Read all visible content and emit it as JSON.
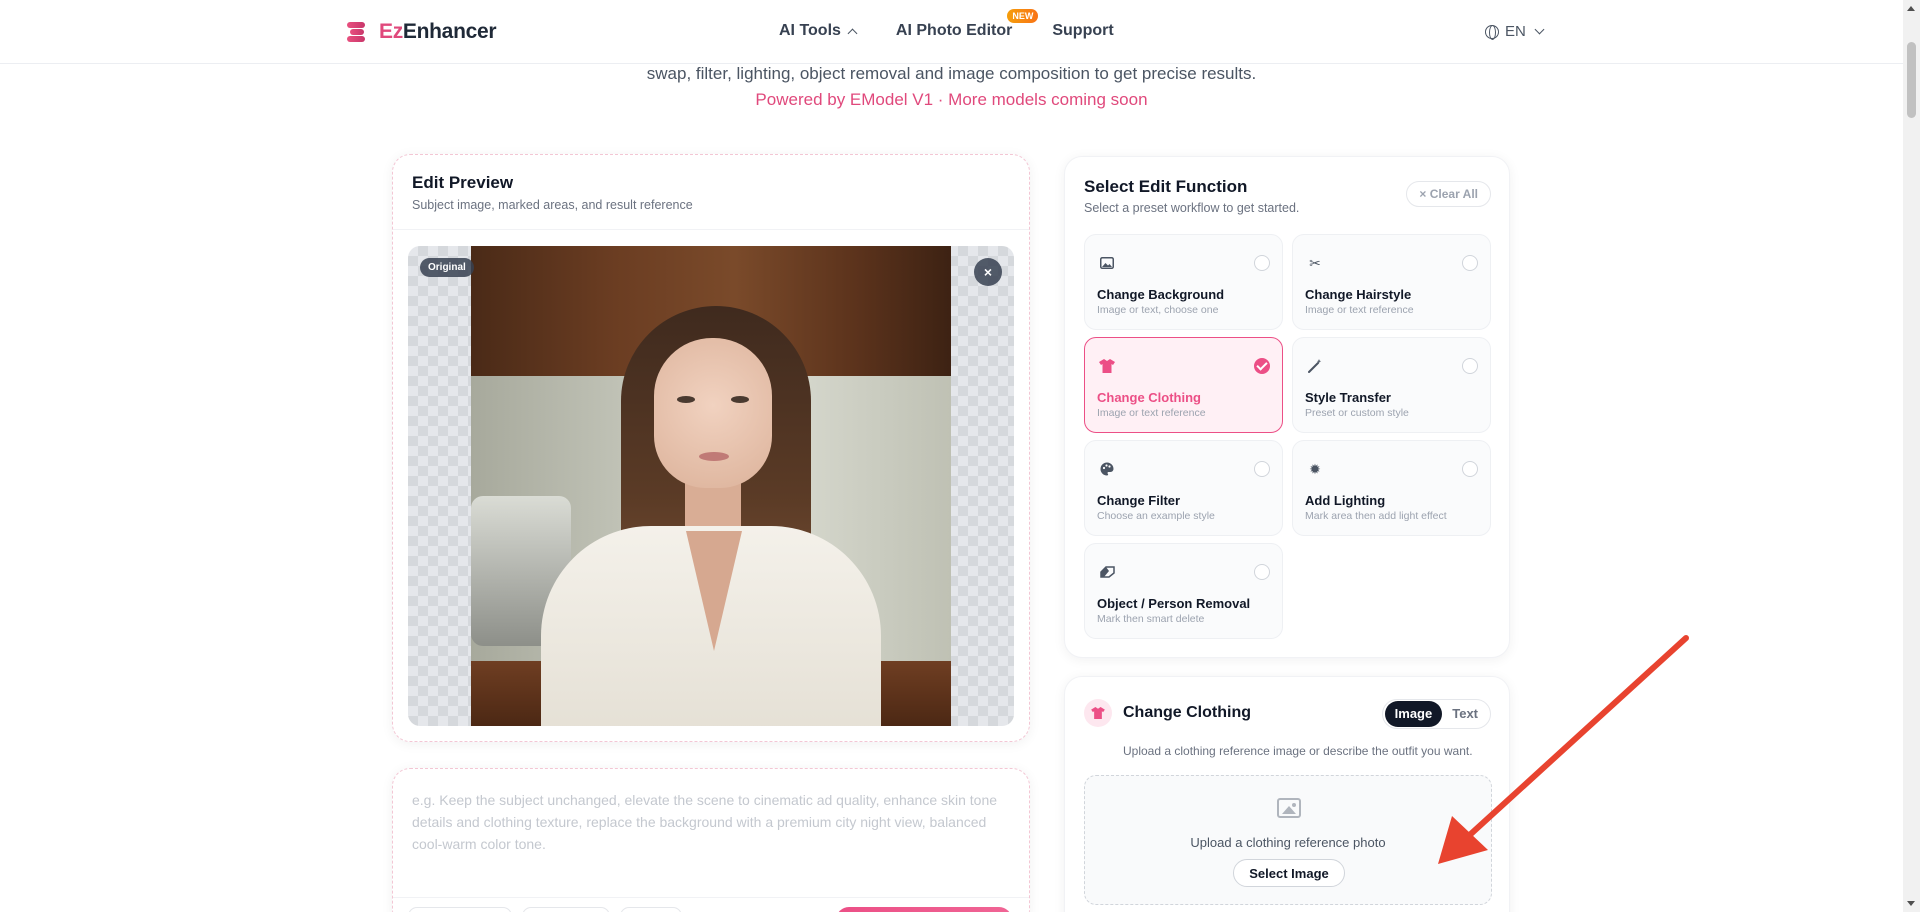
{
  "header": {
    "logo": {
      "prefix": "Ez",
      "suffix": "Enhancer"
    },
    "nav": {
      "ai_tools": "AI Tools",
      "photo_editor": "AI Photo Editor",
      "photo_editor_badge": "NEW",
      "support": "Support"
    },
    "language": "EN"
  },
  "hero": {
    "description": "swap, filter, lighting, object removal and image composition to get precise results.",
    "powered_by": "Powered by EModel V1 · More models coming soon"
  },
  "preview": {
    "title": "Edit Preview",
    "subtitle": "Subject image, marked areas, and result reference",
    "tag": "Original",
    "close_symbol": "×"
  },
  "prompt": {
    "placeholder": "e.g. Keep the subject unchanged, elevate the scene to cinematic ad quality, enhance skin tone details and clothing texture, replace the background with a premium city night view, balanced cool-warm color tone."
  },
  "functions": {
    "title": "Select Edit Function",
    "subtitle": "Select a preset workflow to get started.",
    "clear_label": "× Clear All",
    "selected": "change-clothing",
    "options": [
      {
        "title": "Change Background",
        "desc": "Image or text, choose one",
        "icon": "image-icon"
      },
      {
        "title": "Change Hairstyle",
        "desc": "Image or text reference",
        "icon": "scissors-icon"
      },
      {
        "title": "Change Clothing",
        "desc": "Image or text reference",
        "icon": "shirt-icon"
      },
      {
        "title": "Style Transfer",
        "desc": "Preset or custom style",
        "icon": "magic-wand-icon"
      },
      {
        "title": "Change Filter",
        "desc": "Choose an example style",
        "icon": "palette-icon"
      },
      {
        "title": "Add Lighting",
        "desc": "Mark area then add light effect",
        "icon": "sun-icon"
      },
      {
        "title": "Object / Person Removal",
        "desc": "Mark then smart delete",
        "icon": "eraser-icon"
      }
    ]
  },
  "clothing": {
    "title": "Change Clothing",
    "mode_image": "Image",
    "mode_text": "Text",
    "active_mode": "Image",
    "subtitle": "Upload a clothing reference image or describe the outfit you want.",
    "upload_text": "Upload a clothing reference photo",
    "select_button": "Select Image"
  },
  "colors": {
    "brand": "#e0497c",
    "accent": "#ec4f86",
    "arrow": "#e8432f"
  }
}
